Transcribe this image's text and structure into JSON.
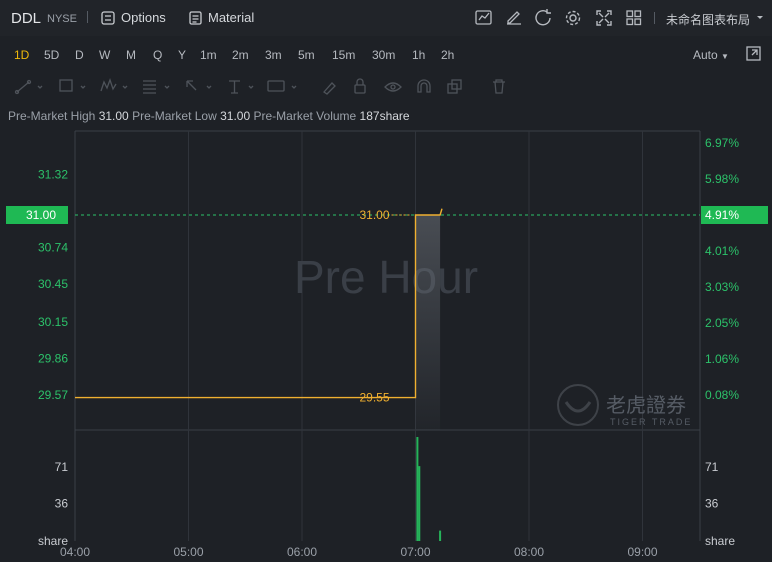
{
  "header": {
    "ticker": "DDL",
    "exchange": "NYSE",
    "options_label": "Options",
    "material_label": "Material",
    "layout_label": "未命名图表布局"
  },
  "periods": [
    "1D",
    "5D",
    "D",
    "W",
    "M",
    "Q",
    "Y",
    "1m",
    "2m",
    "3m",
    "5m",
    "15m",
    "30m",
    "1h",
    "2h"
  ],
  "active_period": "1D",
  "scale_mode": "Auto",
  "info": {
    "high_label": "Pre-Market High",
    "high_value": "31.00",
    "low_label": "Pre-Market Low",
    "low_value": "31.00",
    "volume_label": "Pre-Market Volume",
    "volume_value": "187share"
  },
  "watermark": {
    "text": "Pre Hour",
    "brand_cn": "老虎證券",
    "brand_en": "TIGER TRADE"
  },
  "colors": {
    "up": "#26b35a",
    "line": "#f0b030",
    "price_label_bg": "#1fb954"
  },
  "chart_data": {
    "type": "line",
    "x_ticks": [
      "04:00",
      "05:00",
      "06:00",
      "07:00",
      "08:00",
      "09:00"
    ],
    "y_left_ticks": [
      "31.32",
      "31.00",
      "30.74",
      "30.45",
      "30.15",
      "29.86",
      "29.57"
    ],
    "y_right_ticks": [
      "6.97%",
      "5.98%",
      "4.91%",
      "4.01%",
      "3.03%",
      "2.05%",
      "1.06%",
      "0.08%"
    ],
    "current_price": "31.00",
    "current_pct": "4.91%",
    "series": [
      {
        "points": [
          [
            "04:00",
            29.55
          ],
          [
            "07:00",
            29.55
          ],
          [
            "07:00",
            31.0
          ],
          [
            "07:13",
            31.0
          ],
          [
            "07:14",
            31.05
          ]
        ]
      }
    ],
    "annotations": [
      {
        "text": "31.00",
        "x": "07:00",
        "y": 31.0
      },
      {
        "text": "29.55",
        "x": "07:00",
        "y": 29.55
      }
    ],
    "volume": {
      "unit": "share",
      "y_ticks": [
        "71",
        "36"
      ],
      "bars": [
        [
          "07:01",
          100
        ],
        [
          "07:02",
          72
        ],
        [
          "07:13",
          10
        ]
      ]
    }
  }
}
